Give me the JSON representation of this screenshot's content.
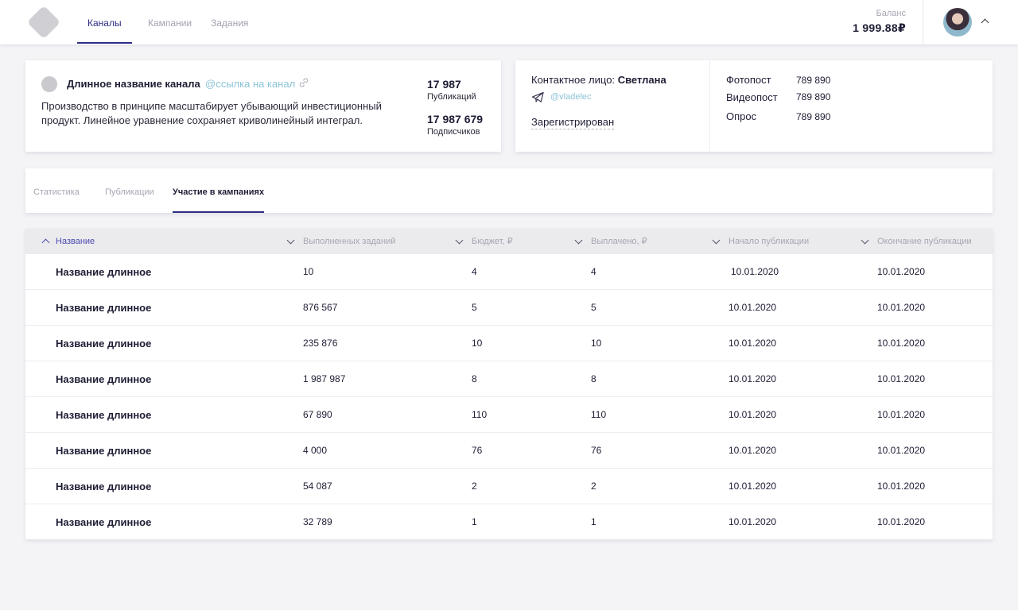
{
  "header": {
    "nav": [
      "Каналы",
      "Кампании",
      "Задания"
    ],
    "balance_label": "Баланс",
    "balance_value": "1 999.88₽"
  },
  "channel": {
    "name": "Длинное название канала",
    "link": "@ссылка на канал",
    "description": "Производство в принципе масштабирует убывающий инвестиционный продукт. Линейное уравнение сохраняет криволинейный интеграл.",
    "publications_count": "17 987",
    "publications_label": "Публикаций",
    "subscribers_count": "17 987 679",
    "subscribers_label": "Подписчиков"
  },
  "contact": {
    "label": "Контактное лицо:",
    "name": "Светлана",
    "telegram": "@vladelec",
    "status": "Зарегистрирован",
    "prices": [
      {
        "label": "Фотопост",
        "value": "789 890"
      },
      {
        "label": "Видеопост",
        "value": "789 890"
      },
      {
        "label": "Опрос",
        "value": "789 890"
      }
    ]
  },
  "tabs": [
    "Статистика",
    "Публикации",
    "Участие в кампаниях"
  ],
  "table": {
    "headers": [
      "Название",
      "Выполненных заданий",
      "Бюджет, ₽",
      "Выплачено, ₽",
      "Начало публикации",
      "Окончание публикации"
    ],
    "rows": [
      [
        "Название длинное",
        "10",
        "4",
        "4",
        "10.01.2020",
        "10.01.2020"
      ],
      [
        "Название длинное",
        "876 567",
        "5",
        "5",
        "10.01.2020",
        "10.01.2020"
      ],
      [
        "Название длинное",
        "235 876",
        "10",
        "10",
        "10.01.2020",
        "10.01.2020"
      ],
      [
        "Название длинное",
        "1 987 987",
        "8",
        "8",
        "10.01.2020",
        "10.01.2020"
      ],
      [
        "Название длинное",
        "67 890",
        "110",
        "110",
        "10.01.2020",
        "10.01.2020"
      ],
      [
        "Название длинное",
        "4 000",
        "76",
        "76",
        "10.01.2020",
        "10.01.2020"
      ],
      [
        "Название длинное",
        "54 087",
        "2",
        "2",
        "10.01.2020",
        "10.01.2020"
      ],
      [
        "Название длинное",
        "32 789",
        "1",
        "1",
        "10.01.2020",
        "10.01.2020"
      ]
    ]
  }
}
